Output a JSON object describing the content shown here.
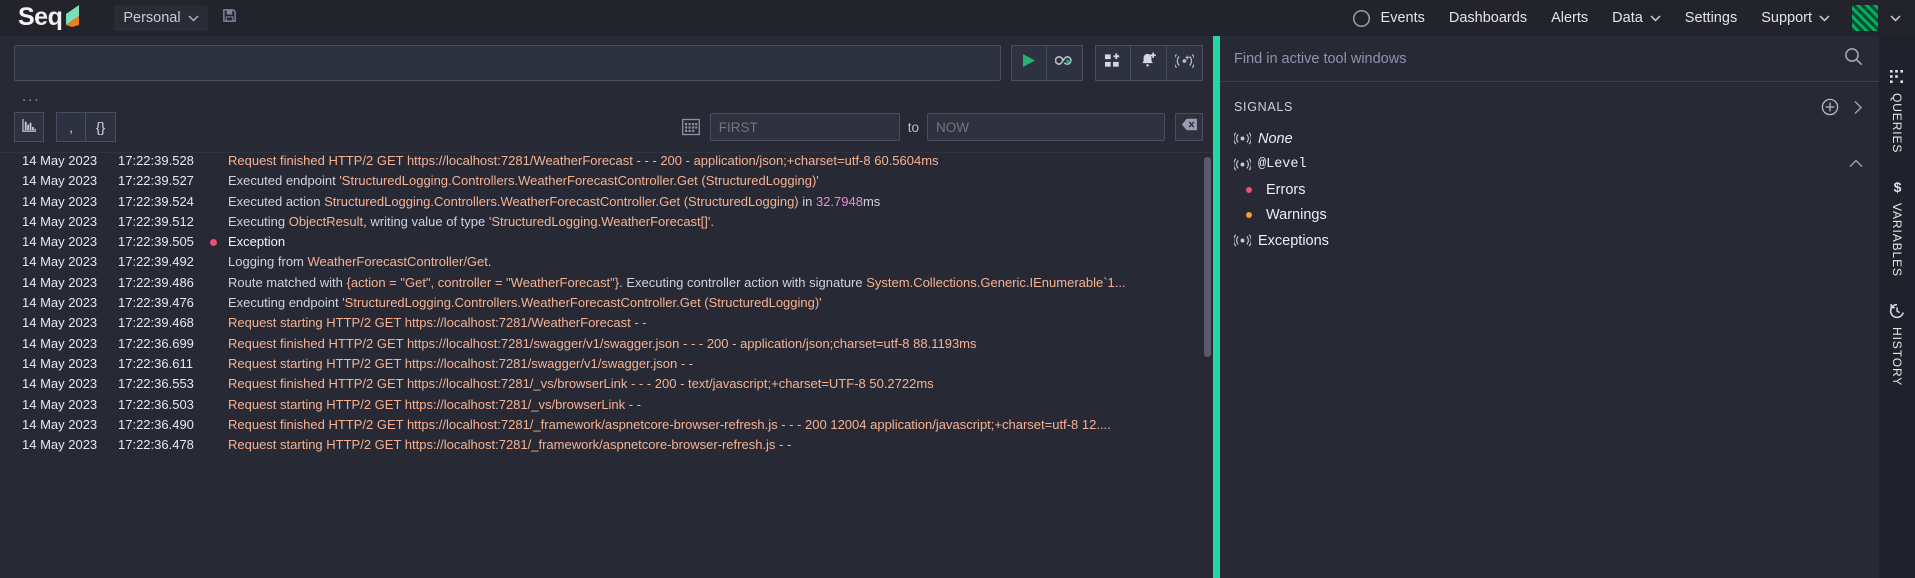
{
  "topnav": {
    "brand": "Seq",
    "environment": "Personal",
    "save_icon": "save-icon",
    "theme_toggle_icon": "moon-icon",
    "links": [
      {
        "label": "Events",
        "caret": false
      },
      {
        "label": "Dashboards",
        "caret": false
      },
      {
        "label": "Alerts",
        "caret": false
      },
      {
        "label": "Data",
        "caret": true
      },
      {
        "label": "Settings",
        "caret": false
      },
      {
        "label": "Support",
        "caret": true
      }
    ]
  },
  "query": {
    "value": "",
    "placeholder": "",
    "ellipsis": "...",
    "buttons": [
      {
        "name": "run-query-button",
        "icon": "play-icon"
      },
      {
        "name": "tail-query-button",
        "icon": "infinity-loop-icon"
      },
      {
        "name": "add-to-dashboard-button",
        "icon": "dashboard-add-icon"
      },
      {
        "name": "create-alert-button",
        "icon": "bell-add-icon"
      },
      {
        "name": "create-signal-button",
        "icon": "signal-add-icon"
      }
    ],
    "view_buttons": [
      {
        "name": "chart-view-button",
        "icon": "bar-chart-icon",
        "label": ""
      },
      {
        "name": "raw-view-button",
        "icon": "comma-icon",
        "label": "‚"
      },
      {
        "name": "json-view-button",
        "icon": "braces-icon",
        "label": "{}"
      }
    ]
  },
  "range": {
    "calendar_icon": "calendar-icon",
    "from_value": "FIRST",
    "from_placeholder": "FIRST",
    "to_label": "to",
    "to_value": "NOW",
    "to_placeholder": "NOW",
    "clear_icon": "clear-range-icon"
  },
  "events": [
    {
      "date": "14 May 2023",
      "time": "17:22:39.528",
      "level": "",
      "parts": [
        {
          "t": "Request finished HTTP/2 GET https://localhost:7281/WeatherForecast - - - 200 - application/json;+charset=utf-8 60.5604ms",
          "c": "tok-str"
        }
      ]
    },
    {
      "date": "14 May 2023",
      "time": "17:22:39.527",
      "level": "",
      "parts": [
        {
          "t": "Executed endpoint ",
          "c": "tok-txt"
        },
        {
          "t": "'StructuredLogging.Controllers.WeatherForecastController.Get (StructuredLogging)'",
          "c": "tok-str"
        }
      ]
    },
    {
      "date": "14 May 2023",
      "time": "17:22:39.524",
      "level": "",
      "parts": [
        {
          "t": "Executed action ",
          "c": "tok-txt"
        },
        {
          "t": "StructuredLogging.Controllers.WeatherForecastController.Get (StructuredLogging)",
          "c": "tok-str"
        },
        {
          "t": " in ",
          "c": "tok-txt"
        },
        {
          "t": "32.7948",
          "c": "tok-num"
        },
        {
          "t": "ms",
          "c": "tok-txt"
        }
      ]
    },
    {
      "date": "14 May 2023",
      "time": "17:22:39.512",
      "level": "",
      "parts": [
        {
          "t": "Executing ",
          "c": "tok-txt"
        },
        {
          "t": "ObjectResult",
          "c": "tok-str"
        },
        {
          "t": ", writing value of type ",
          "c": "tok-txt"
        },
        {
          "t": "'StructuredLogging.WeatherForecast[]'",
          "c": "tok-str"
        },
        {
          "t": ".",
          "c": "tok-txt"
        }
      ]
    },
    {
      "date": "14 May 2023",
      "time": "17:22:39.505",
      "level": "error",
      "parts": [
        {
          "t": "Exception",
          "c": "tok-err"
        }
      ]
    },
    {
      "date": "14 May 2023",
      "time": "17:22:39.492",
      "level": "",
      "parts": [
        {
          "t": "Logging from ",
          "c": "tok-txt"
        },
        {
          "t": "WeatherForecastController/Get",
          "c": "tok-str"
        },
        {
          "t": ".",
          "c": "tok-txt"
        }
      ]
    },
    {
      "date": "14 May 2023",
      "time": "17:22:39.486",
      "level": "",
      "parts": [
        {
          "t": "Route matched with ",
          "c": "tok-txt"
        },
        {
          "t": "{action = \"Get\", controller = \"WeatherForecast\"}",
          "c": "tok-str"
        },
        {
          "t": ". Executing controller action with signature ",
          "c": "tok-txt"
        },
        {
          "t": "System.Collections.Generic.IEnumerable`1...",
          "c": "tok-str"
        }
      ]
    },
    {
      "date": "14 May 2023",
      "time": "17:22:39.476",
      "level": "",
      "parts": [
        {
          "t": "Executing endpoint ",
          "c": "tok-txt"
        },
        {
          "t": "'StructuredLogging.Controllers.WeatherForecastController.Get (StructuredLogging)'",
          "c": "tok-str"
        }
      ]
    },
    {
      "date": "14 May 2023",
      "time": "17:22:39.468",
      "level": "",
      "parts": [
        {
          "t": "Request starting HTTP/2 GET https://localhost:7281/WeatherForecast - -",
          "c": "tok-str"
        }
      ]
    },
    {
      "date": "14 May 2023",
      "time": "17:22:36.699",
      "level": "",
      "parts": [
        {
          "t": "Request finished HTTP/2 GET https://localhost:7281/swagger/v1/swagger.json - - - 200 - application/json;charset=utf-8 88.1193ms",
          "c": "tok-str"
        }
      ]
    },
    {
      "date": "14 May 2023",
      "time": "17:22:36.611",
      "level": "",
      "parts": [
        {
          "t": "Request starting HTTP/2 GET https://localhost:7281/swagger/v1/swagger.json - -",
          "c": "tok-str"
        }
      ]
    },
    {
      "date": "14 May 2023",
      "time": "17:22:36.553",
      "level": "",
      "parts": [
        {
          "t": "Request finished HTTP/2 GET https://localhost:7281/_vs/browserLink - - - 200 - text/javascript;+charset=UTF-8 50.2722ms",
          "c": "tok-str"
        }
      ]
    },
    {
      "date": "14 May 2023",
      "time": "17:22:36.503",
      "level": "",
      "parts": [
        {
          "t": "Request starting HTTP/2 GET https://localhost:7281/_vs/browserLink - -",
          "c": "tok-str"
        }
      ]
    },
    {
      "date": "14 May 2023",
      "time": "17:22:36.490",
      "level": "",
      "parts": [
        {
          "t": "Request finished HTTP/2 GET https://localhost:7281/_framework/aspnetcore-browser-refresh.js - - - 200 12004 application/javascript;+charset=utf-8 12....",
          "c": "tok-str"
        }
      ]
    },
    {
      "date": "14 May 2023",
      "time": "17:22:36.478",
      "level": "",
      "parts": [
        {
          "t": "Request starting HTTP/2 GET https://localhost:7281/_framework/aspnetcore-browser-refresh.js - -",
          "c": "tok-str"
        }
      ]
    }
  ],
  "right": {
    "find_value": "",
    "find_placeholder": "Find in active tool windows",
    "search_icon": "search-icon",
    "section_title": "SIGNALS",
    "add_icon": "plus-circle-icon",
    "expand_icon": "chevron-right-icon",
    "signals": [
      {
        "label": "None",
        "icon": "signal-icon",
        "style": "italic",
        "child": false,
        "collapse": false
      },
      {
        "label": "@Level",
        "icon": "signal-icon",
        "style": "mono",
        "child": false,
        "collapse": true
      },
      {
        "label": "Errors",
        "icon": "bullet",
        "color": "#f04e74",
        "child": true,
        "collapse": false
      },
      {
        "label": "Warnings",
        "icon": "bullet",
        "color": "#eea033",
        "child": true,
        "collapse": false
      },
      {
        "label": "Exceptions",
        "icon": "signal-icon",
        "style": "",
        "child": false,
        "collapse": false
      }
    ]
  },
  "rail": [
    {
      "label": "QUERIES",
      "icon": "queries-icon"
    },
    {
      "label": "VARIABLES",
      "icon": "dollar-icon"
    },
    {
      "label": "HISTORY",
      "icon": "history-icon"
    }
  ],
  "colors": {
    "accent": "#24d6a4",
    "error": "#f04e74",
    "warning": "#eea033",
    "play": "#21b46b",
    "background": "#272a35",
    "nav_background": "#23232b"
  }
}
